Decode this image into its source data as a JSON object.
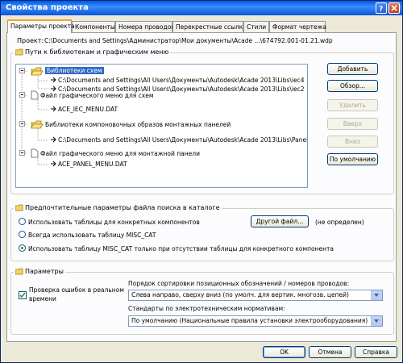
{
  "window": {
    "title": "Свойства проекта"
  },
  "tabs": [
    {
      "label": "Параметры проекта"
    },
    {
      "label": "Компоненты"
    },
    {
      "label": "Номера проводов"
    },
    {
      "label": "Перекрестные ссылки"
    },
    {
      "label": "Стили"
    },
    {
      "label": "Формат чертежа"
    }
  ],
  "project": {
    "label": "Проект:",
    "path": "C:\\Documents and Settings\\Администратор\\Мои документы\\Acade ...\\674792.001-01.21.wdp"
  },
  "libraries_group": {
    "title": "Пути к библиотекам и графическим меню",
    "tree": [
      {
        "label": "Библиотеки схем"
      },
      {
        "label": "C:\\Documents and Settings\\All Users\\Документы\\Autodesk\\Acade 2013\\Libs\\iec4"
      },
      {
        "label": "C:\\Documents and Settings\\All Users\\Документы\\Autodesk\\Acade 2013\\Libs\\iec2"
      },
      {
        "label": "Файл графического меню для схем"
      },
      {
        "label": "ACE_IEC_MENU.DAT"
      },
      {
        "label": "Библиотеки компоновочных образов монтажных панелей"
      },
      {
        "label": "C:\\Documents and Settings\\All Users\\Документы\\Autodesk\\Acade 2013\\Libs\\Panel"
      },
      {
        "label": "Файл графического меню для монтажной панели"
      },
      {
        "label": "ACE_PANEL_MENU.DAT"
      }
    ],
    "buttons": {
      "add": "Добавить",
      "browse": "Обзор...",
      "delete": "Удалить",
      "up": "Вверх",
      "down": "Вниз",
      "default": "По умолчанию"
    }
  },
  "catalog_group": {
    "title": "Предпочтительные параметры файла поиска в каталоге",
    "options": [
      {
        "label": "Использовать таблицы для конкретных компонентов",
        "selected": false
      },
      {
        "label": "Всегда использовать таблицу MISC_CAT",
        "selected": false
      },
      {
        "label": "Использовать таблицу MISC_CAT только при отсутствии таблицы для конкретного компонента",
        "selected": true
      }
    ],
    "other_file_button": "Другой файл...",
    "other_file_status": "(не определен)"
  },
  "params_group": {
    "title": "Параметры",
    "error_check": {
      "label_line1": "Проверка ошибок в реальном",
      "label_line2": "времени",
      "checked": true
    },
    "sort_order": {
      "label": "Порядок сортировки позиционных обозначений / номеров проводов:",
      "value": "Слева направо, сверху вниз (по умолч. для вертик. многозв. цепей)"
    },
    "standards": {
      "label": "Стандарты по электротехническим нормативам:",
      "value": "По умолчанию (Национальные правила установки электрооборудования)"
    }
  },
  "footer": {
    "ok": "OK",
    "cancel": "Отмена",
    "help": "Справка"
  },
  "colors": {
    "titlebar": "#0a56d8",
    "selection": "#316ac5",
    "face": "#ece9d8",
    "tab_accent": "#f5a623"
  }
}
